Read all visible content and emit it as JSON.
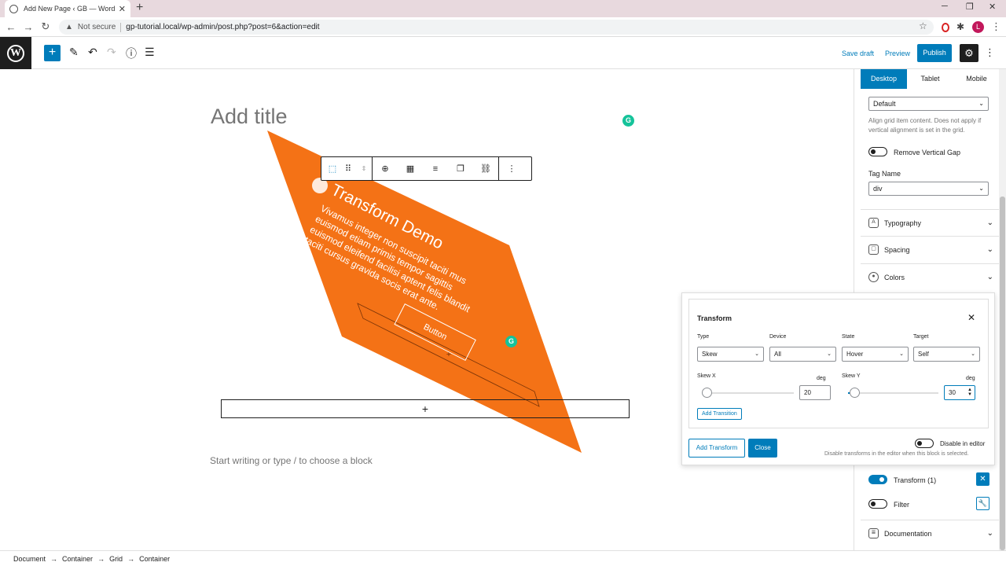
{
  "browser": {
    "tab_title": "Add New Page ‹ GB — WordPress",
    "new_tab": "+",
    "security_label": "Not secure",
    "url": "gp-tutorial.local/wp-admin/post.php?post=6&action=edit",
    "avatar_letter": "L"
  },
  "toolbar": {
    "save_draft": "Save draft",
    "preview": "Preview",
    "publish": "Publish"
  },
  "editor": {
    "title_placeholder": "Add title",
    "demo": {
      "title": "Transform Demo",
      "body": "Vivamus integer non suscipit taciti mus euismod etiam primis tempor sagittis euismod eleifend facilisi aptent felis blandit taciti cursus gravida socis erat ante.",
      "button": "Button"
    },
    "inserter": "+",
    "placeholder": "Start writing or type / to choose a block"
  },
  "sidebar": {
    "device_tabs": [
      "Desktop",
      "Tablet",
      "Mobile"
    ],
    "vertical_alignment_value": "Default",
    "vertical_alignment_help": "Align grid item content. Does not apply if vertical alignment is set in the grid.",
    "remove_vertical_gap": "Remove Vertical Gap",
    "tag_name_label": "Tag Name",
    "tag_name_value": "div",
    "panels": [
      "Typography",
      "Spacing",
      "Colors"
    ],
    "transform_label": "Transform (1)",
    "filter_label": "Filter",
    "documentation": "Documentation"
  },
  "transform_popover": {
    "title": "Transform",
    "type_label": "Type",
    "type_value": "Skew",
    "device_label": "Device",
    "device_value": "All",
    "state_label": "State",
    "state_value": "Hover",
    "target_label": "Target",
    "target_value": "Self",
    "skew_x_label": "Skew X",
    "skew_x_unit": "deg",
    "skew_x_value": "20",
    "skew_y_label": "Skew Y",
    "skew_y_unit": "deg",
    "skew_y_value": "30",
    "add_transition": "Add Transition",
    "add_transform": "Add Transform",
    "close": "Close",
    "disable_in_editor": "Disable in editor",
    "disable_help": "Disable transforms in the editor when this block is selected."
  },
  "breadcrumb": [
    "Document",
    "Container",
    "Grid",
    "Container"
  ],
  "colors": {
    "accent": "#007cba",
    "shape": "#f47216",
    "grammarly": "#15c39a"
  }
}
